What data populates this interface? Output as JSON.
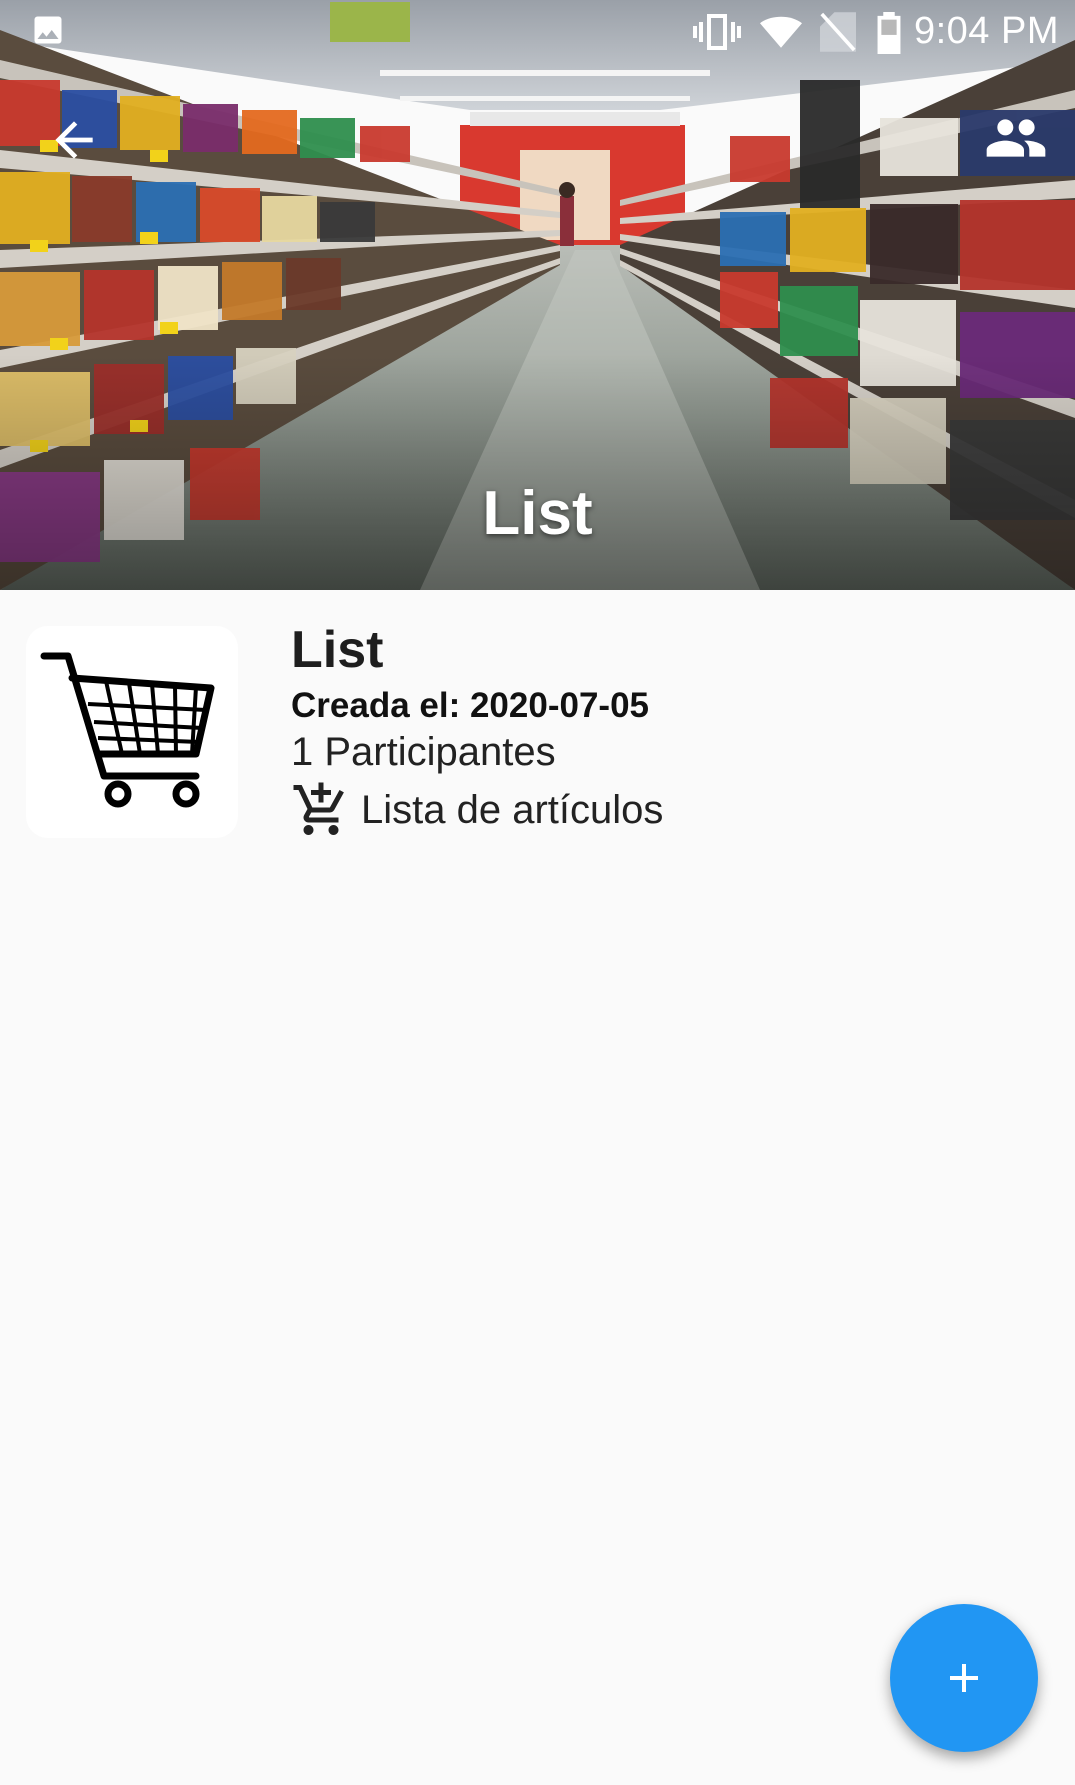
{
  "status_bar": {
    "time": "9:04 PM",
    "icons": [
      "image-notification-icon",
      "vibrate-icon",
      "wifi-icon",
      "no-sim-icon",
      "battery-icon"
    ]
  },
  "app_bar": {
    "title": "List",
    "back_icon": "arrow-back-icon",
    "participants_icon": "group-icon"
  },
  "list_card": {
    "title": "List",
    "created": "Creada el: 2020-07-05",
    "participants": "1 Participantes",
    "items_link": "Lista de artículos",
    "items_icon": "add-shopping-cart-icon",
    "thumbnail_icon": "shopping-cart-icon"
  },
  "fab": {
    "icon": "add-icon"
  },
  "colors": {
    "accent": "#2196f3",
    "background": "#fafafa",
    "text_primary": "#1e1e1e"
  }
}
